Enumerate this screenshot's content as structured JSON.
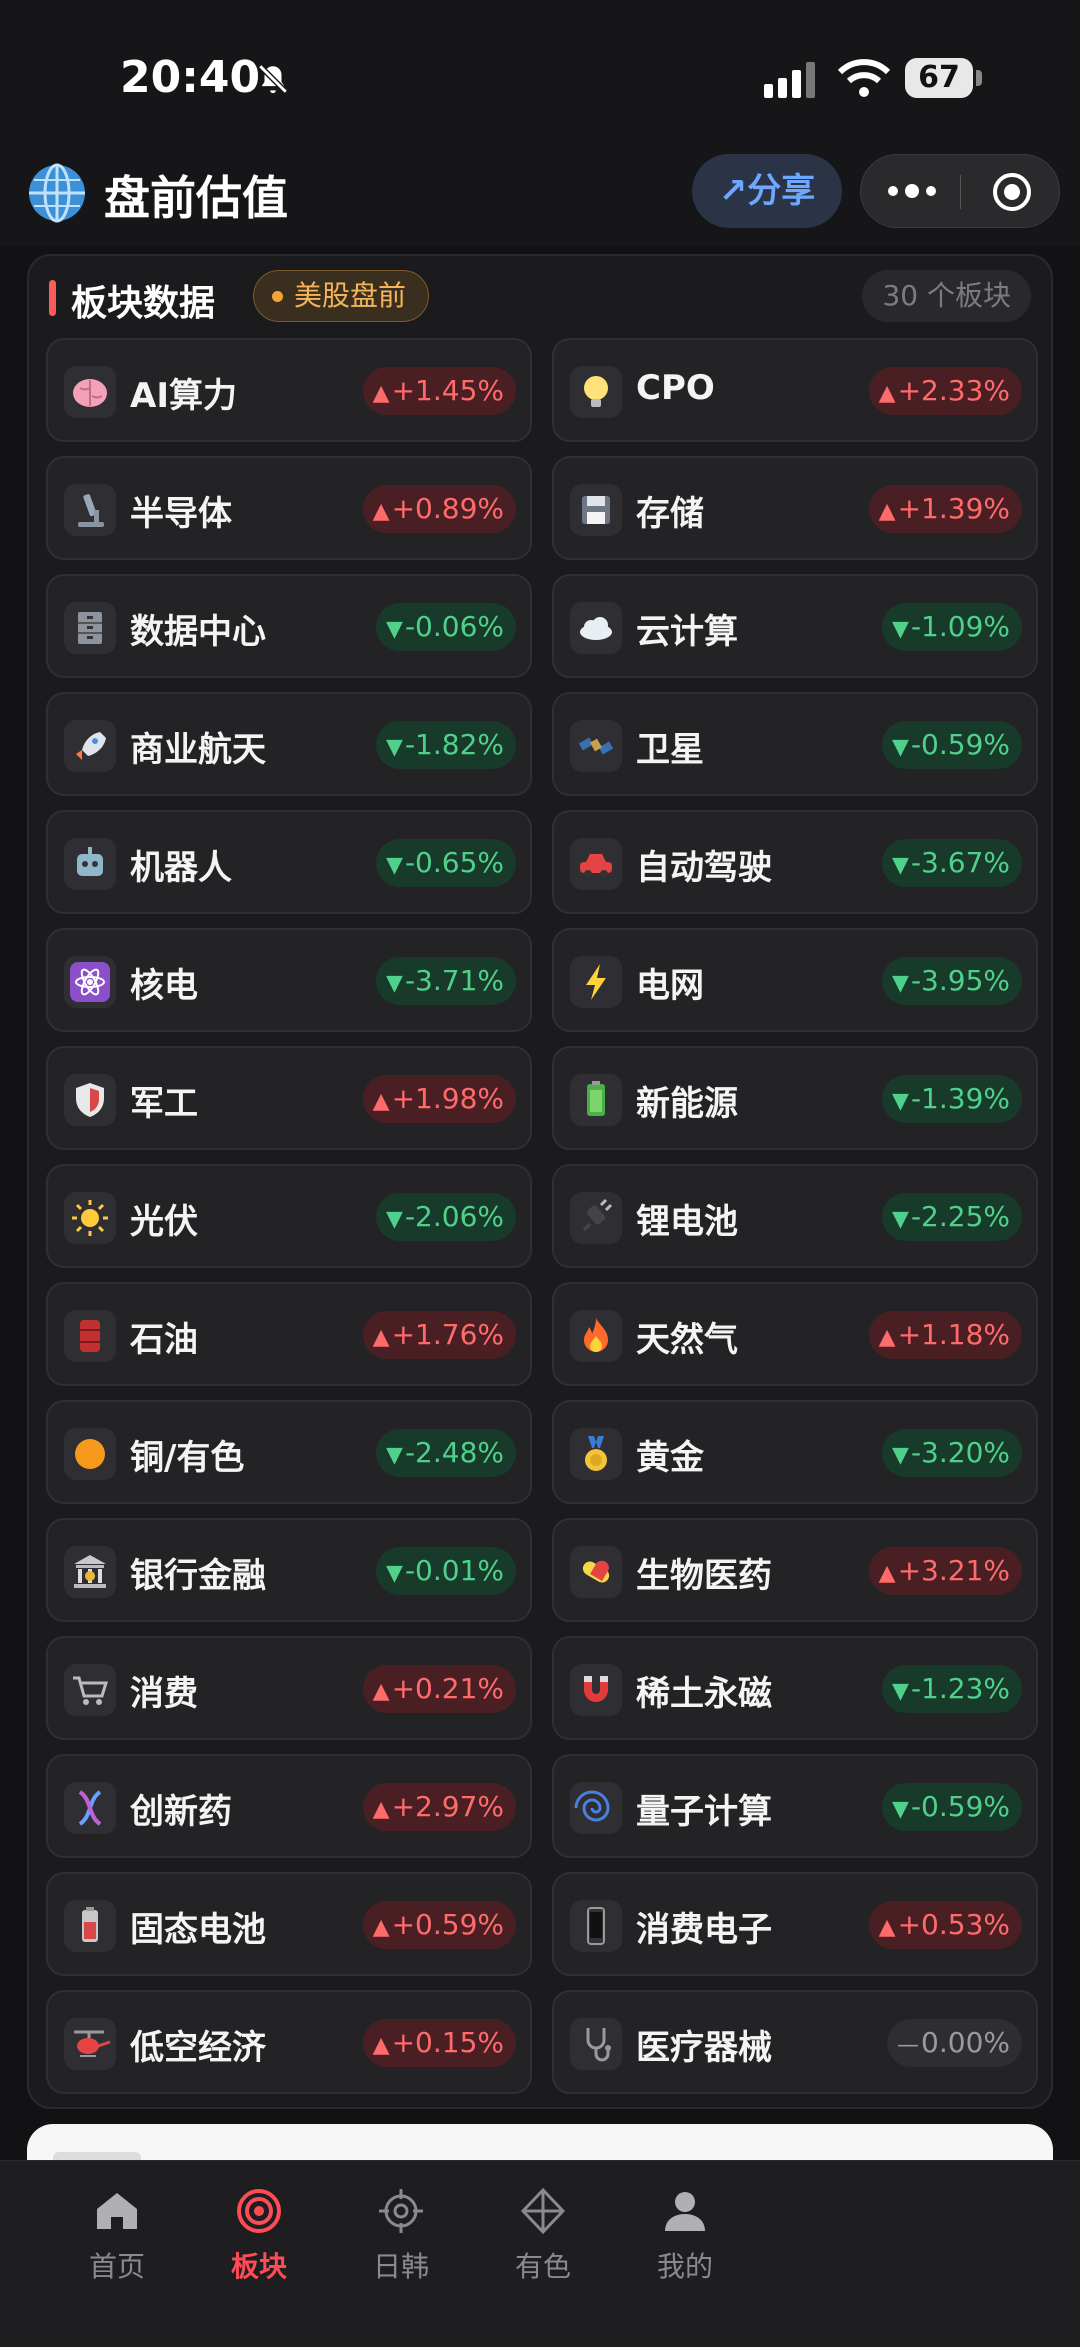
{
  "status_bar": {
    "time": "20:40",
    "battery": "67"
  },
  "header": {
    "title": "盘前估值",
    "share_label": "分享"
  },
  "section": {
    "title": "板块数据",
    "badge": "美股盘前",
    "count": "30 个板块"
  },
  "sectors": [
    {
      "name": "AI算力",
      "icon": "brain-icon",
      "change": "+1.45%",
      "trend": "up"
    },
    {
      "name": "CPO",
      "icon": "lightbulb-icon",
      "change": "+2.33%",
      "trend": "up"
    },
    {
      "name": "半导体",
      "icon": "microscope-icon",
      "change": "+0.89%",
      "trend": "up"
    },
    {
      "name": "存储",
      "icon": "floppy-disk-icon",
      "change": "+1.39%",
      "trend": "up"
    },
    {
      "name": "数据中心",
      "icon": "file-cabinet-icon",
      "change": "-0.06%",
      "trend": "down"
    },
    {
      "name": "云计算",
      "icon": "cloud-icon",
      "change": "-1.09%",
      "trend": "down"
    },
    {
      "name": "商业航天",
      "icon": "rocket-icon",
      "change": "-1.82%",
      "trend": "down"
    },
    {
      "name": "卫星",
      "icon": "satellite-icon",
      "change": "-0.59%",
      "trend": "down"
    },
    {
      "name": "机器人",
      "icon": "robot-icon",
      "change": "-0.65%",
      "trend": "down"
    },
    {
      "name": "自动驾驶",
      "icon": "car-icon",
      "change": "-3.67%",
      "trend": "down"
    },
    {
      "name": "核电",
      "icon": "atom-icon",
      "change": "-3.71%",
      "trend": "down"
    },
    {
      "name": "电网",
      "icon": "lightning-icon",
      "change": "-3.95%",
      "trend": "down"
    },
    {
      "name": "军工",
      "icon": "shield-icon",
      "change": "+1.98%",
      "trend": "up"
    },
    {
      "name": "新能源",
      "icon": "battery-icon",
      "change": "-1.39%",
      "trend": "down"
    },
    {
      "name": "光伏",
      "icon": "sun-icon",
      "change": "-2.06%",
      "trend": "down"
    },
    {
      "name": "锂电池",
      "icon": "plug-icon",
      "change": "-2.25%",
      "trend": "down"
    },
    {
      "name": "石油",
      "icon": "oil-drum-icon",
      "change": "+1.76%",
      "trend": "up"
    },
    {
      "name": "天然气",
      "icon": "fire-icon",
      "change": "+1.18%",
      "trend": "up"
    },
    {
      "name": "铜/有色",
      "icon": "orange-circle-icon",
      "change": "-2.48%",
      "trend": "down"
    },
    {
      "name": "黄金",
      "icon": "gold-medal-icon",
      "change": "-3.20%",
      "trend": "down"
    },
    {
      "name": "银行金融",
      "icon": "bank-icon",
      "change": "-0.01%",
      "trend": "down"
    },
    {
      "name": "生物医药",
      "icon": "pill-icon",
      "change": "+3.21%",
      "trend": "up"
    },
    {
      "name": "消费",
      "icon": "shopping-cart-icon",
      "change": "+0.21%",
      "trend": "up"
    },
    {
      "name": "稀土永磁",
      "icon": "magnet-icon",
      "change": "-1.23%",
      "trend": "down"
    },
    {
      "name": "创新药",
      "icon": "dna-icon",
      "change": "+2.97%",
      "trend": "up"
    },
    {
      "name": "量子计算",
      "icon": "cyclone-icon",
      "change": "-0.59%",
      "trend": "down"
    },
    {
      "name": "固态电池",
      "icon": "battery-cell-icon",
      "change": "+0.59%",
      "trend": "up"
    },
    {
      "name": "消费电子",
      "icon": "phone-icon",
      "change": "+0.53%",
      "trend": "up"
    },
    {
      "name": "低空经济",
      "icon": "helicopter-icon",
      "change": "+0.15%",
      "trend": "up"
    },
    {
      "name": "医疗器械",
      "icon": "stethoscope-icon",
      "change": "0.00%",
      "trend": "flat"
    }
  ],
  "trend_symbols": {
    "up": "▲",
    "down": "▼",
    "flat": "—"
  },
  "colors": {
    "up": "#ff6b6b",
    "down": "#4fd18b",
    "flat": "#9a9a9e",
    "accent": "#ff4b55",
    "share": "#6fa7ff"
  },
  "bottom_nav": [
    {
      "label": "首页",
      "icon": "home-icon",
      "active": false
    },
    {
      "label": "板块",
      "icon": "target-icon",
      "active": true
    },
    {
      "label": "日韩",
      "icon": "crosshair-icon",
      "active": false
    },
    {
      "label": "有色",
      "icon": "diamond-icon",
      "active": false
    },
    {
      "label": "我的",
      "icon": "user-icon",
      "active": false
    }
  ]
}
